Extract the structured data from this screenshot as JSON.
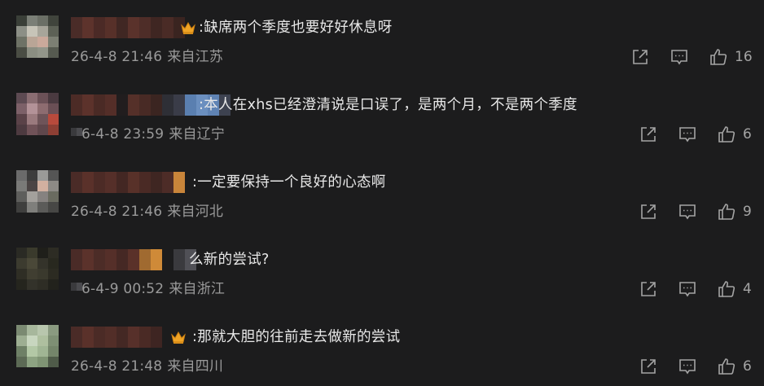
{
  "comments": [
    {
      "text": ":缺席两个季度也要好好休息呀",
      "date": "26-4-8 21:46",
      "location": "来自江苏",
      "likes": "16",
      "badge": "crown-icon"
    },
    {
      "text": ":本人在xhs已经澄清说是口误了，是两个月，不是两个季度",
      "date": "6-4-8 23:59",
      "location": "来自辽宁",
      "likes": "6",
      "badge": ""
    },
    {
      "text": ":一定要保持一个良好的心态啊",
      "date": "26-4-8 21:46",
      "location": "来自河北",
      "likes": "9",
      "badge": ""
    },
    {
      "text": "么新的尝试?",
      "date": "6-4-9 00:52",
      "location": "来自浙江",
      "likes": "4",
      "badge": ""
    },
    {
      "text": ":那就大胆的往前走去做新的尝试",
      "date": "26-4-8 21:48",
      "location": "来自四川",
      "likes": "6",
      "badge": "crown-icon"
    }
  ],
  "icons": {
    "share": "share-icon",
    "reply": "comment-icon",
    "like": "thumbs-up-icon"
  },
  "colors": {
    "background": "#1c1c1d",
    "text": "#e8e8e8",
    "meta": "#9a9a9a",
    "icon": "#a4a4a4",
    "crown": "#f0a426"
  }
}
